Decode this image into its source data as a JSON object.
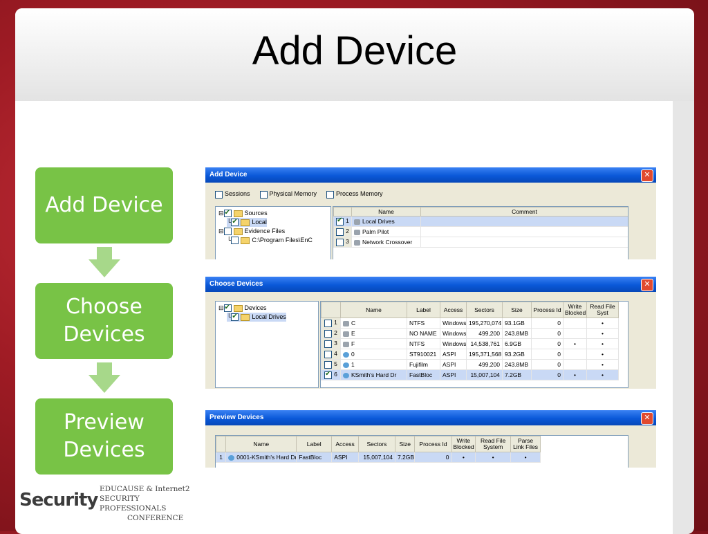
{
  "slide": {
    "title": "Add Device"
  },
  "flow": {
    "steps": [
      "Add Device",
      "Choose\nDevices",
      "Preview\nDevices"
    ]
  },
  "add_device": {
    "title": "Add Device",
    "checkboxes": [
      "Sessions",
      "Physical Memory",
      "Process Memory"
    ],
    "tree": [
      "Sources",
      "Local",
      "Evidence Files",
      "C:\\Program Files\\EnC"
    ],
    "columns": [
      "Name",
      "Comment"
    ],
    "rows": [
      {
        "index": "1",
        "name": "Local Drives",
        "checked": true
      },
      {
        "index": "2",
        "name": "Palm Pilot",
        "checked": false
      },
      {
        "index": "3",
        "name": "Network Crossover",
        "checked": false
      }
    ]
  },
  "choose_devices": {
    "title": "Choose Devices",
    "tree": [
      "Devices",
      "Local Drives"
    ],
    "columns": [
      "Name",
      "Label",
      "Access",
      "Sectors",
      "Size",
      "Process Id",
      "Write Blocked",
      "Read File Syst"
    ],
    "rows": [
      {
        "index": "1",
        "name": "C",
        "label": "NTFS",
        "access": "Windows",
        "sectors": "195,270,074",
        "size": "93.1GB",
        "pid": "0",
        "wb": "",
        "rfs": "•",
        "checked": false
      },
      {
        "index": "2",
        "name": "E",
        "label": "NO NAME",
        "access": "Windows",
        "sectors": "499,200",
        "size": "243.8MB",
        "pid": "0",
        "wb": "",
        "rfs": "•",
        "checked": false
      },
      {
        "index": "3",
        "name": "F",
        "label": "NTFS",
        "access": "Windows",
        "sectors": "14,538,761",
        "size": "6.9GB",
        "pid": "0",
        "wb": "•",
        "rfs": "•",
        "checked": false
      },
      {
        "index": "4",
        "name": "0",
        "label": "ST910021",
        "access": "ASPI",
        "sectors": "195,371,568",
        "size": "93.2GB",
        "pid": "0",
        "wb": "",
        "rfs": "•",
        "checked": false
      },
      {
        "index": "5",
        "name": "1",
        "label": "Fujifilm",
        "access": "ASPI",
        "sectors": "499,200",
        "size": "243.8MB",
        "pid": "0",
        "wb": "",
        "rfs": "•",
        "checked": false
      },
      {
        "index": "6",
        "name": "KSmith's Hard Dr",
        "label": "FastBloc",
        "access": "ASPI",
        "sectors": "15,007,104",
        "size": "7.2GB",
        "pid": "0",
        "wb": "•",
        "rfs": "•",
        "checked": true
      }
    ]
  },
  "preview_devices": {
    "title": "Preview Devices",
    "columns": [
      "Name",
      "Label",
      "Access",
      "Sectors",
      "Size",
      "Process Id",
      "Write Blocked",
      "Read File System",
      "Parse Link Files"
    ],
    "rows": [
      {
        "index": "1",
        "name": "0001-KSmith's Hard Dr",
        "label": "FastBloc",
        "access": "ASPI",
        "sectors": "15,007,104",
        "size": "7.2GB",
        "pid": "0",
        "wb": "•",
        "rfs": "•",
        "plf": "•"
      }
    ]
  },
  "logo": {
    "main": "Security",
    "lines": [
      "EDUCAUSE & Internet2",
      "SECURITY PROFESSIONALS",
      "CONFERENCE"
    ]
  },
  "colors": {
    "flow_green": "#78c346",
    "titlebar_blue": "#0a58d8",
    "selection": "#c9d9f5"
  },
  "icons": [
    "close-icon",
    "folder-icon",
    "drive-icon",
    "down-arrow-icon"
  ]
}
